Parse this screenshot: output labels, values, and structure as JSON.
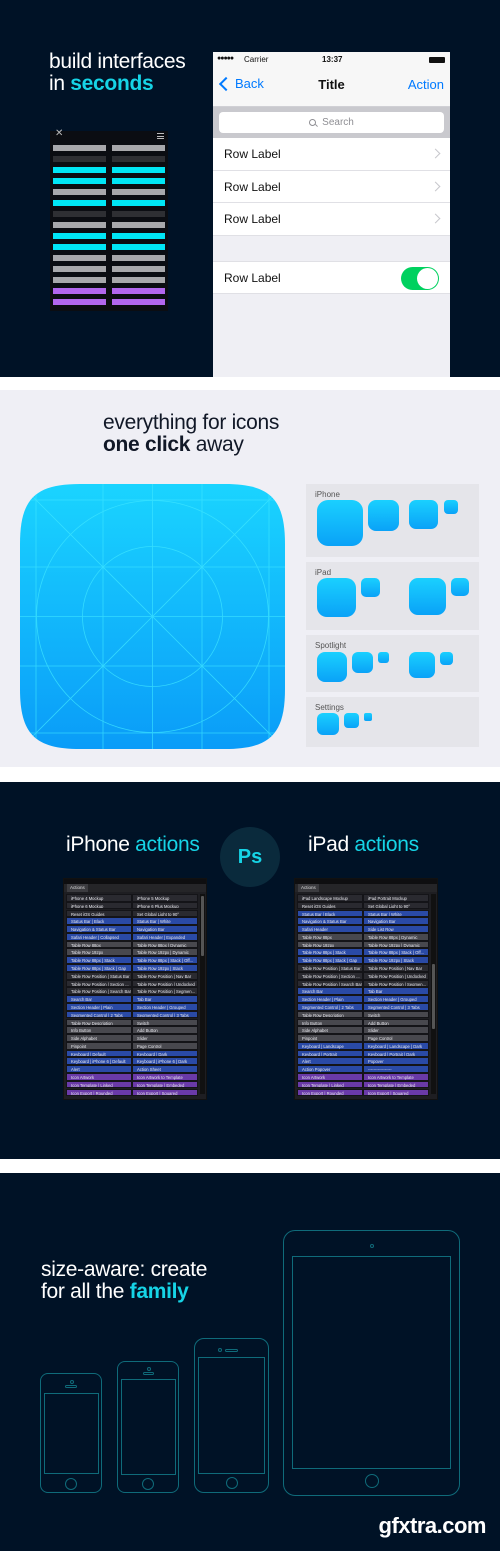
{
  "colors": {
    "dark_bg": "#001226",
    "cyan_accent": "#16d4e6",
    "ios_blue": "#007aff",
    "toggle_green": "#00d15f",
    "light_bg": "#efeff5",
    "device_outline": "#0f6b7a",
    "row_blue": "#2a4aa6",
    "row_gray": "#48484e",
    "row_dark": "#2a2a30",
    "row_purple": "#6a3aa8"
  },
  "section_interfaces": {
    "headline_line1": "build interfaces",
    "headline_line2_plain": "in ",
    "headline_line2_highlight": "seconds",
    "mini_panel": {
      "close_icon": "close-icon",
      "menu_icon": "menu-icon",
      "rows": [
        "gray",
        "dark",
        "cyan",
        "cyan",
        "gray",
        "cyan",
        "dark",
        "gray",
        "cyan",
        "cyan",
        "gray",
        "gray",
        "gray",
        "purple",
        "purple"
      ]
    },
    "phone": {
      "signal": "●●●●●",
      "carrier": "Carrier",
      "time": "13:37",
      "back_label": "Back",
      "title": "Title",
      "action_label": "Action",
      "search_placeholder": "Search",
      "rows": [
        {
          "label": "Row Label",
          "accessory": "disclosure"
        },
        {
          "label": "Row Label",
          "accessory": "disclosure"
        },
        {
          "label": "Row Label",
          "accessory": "disclosure"
        }
      ],
      "toggle_row": {
        "label": "Row Label",
        "on": true
      }
    }
  },
  "section_icons": {
    "headline_line1": "everything for icons",
    "headline_line2_highlight": "one click",
    "headline_line2_plain": " away",
    "cards": [
      {
        "label": "iPhone"
      },
      {
        "label": "iPad"
      },
      {
        "label": "Spotlight"
      },
      {
        "label": "Settings"
      }
    ]
  },
  "section_actions": {
    "left_title_plain": "iPhone ",
    "left_title_highlight": "actions",
    "ps_badge": "Ps",
    "right_title_plain": "iPad ",
    "right_title_highlight": "actions",
    "iphone_panel": {
      "tab": "Actions",
      "rows": [
        {
          "c": "dark",
          "a": "iPhone 4 Mockup",
          "b": "iPhone 5 Mockup"
        },
        {
          "c": "dark",
          "a": "iPhone 6 Mockup",
          "b": "iPhone 6 Plus Mockup"
        },
        {
          "c": "dark",
          "a": "Reset iOS Guides",
          "b": "Set Global Light to 90°"
        },
        {
          "c": "blue",
          "a": "Status Bar | Black",
          "b": "Status Bar | White"
        },
        {
          "c": "blue",
          "a": "Navigation & Status Bar",
          "b": "Navigation Bar"
        },
        {
          "c": "blue",
          "a": "Safari Header | Collapsed",
          "b": "Safari Header | Expanded"
        },
        {
          "c": "gray",
          "a": "Table Row 88px",
          "b": "Table Row 88px | Dynamic"
        },
        {
          "c": "gray",
          "a": "Table Row 192px",
          "b": "Table Row 192px | Dynamic"
        },
        {
          "c": "blue",
          "a": "Table Row 88px | Stack",
          "b": "Table Row 88px | Stack | Off..."
        },
        {
          "c": "blue",
          "a": "Table Row 88px | Stack | Gap",
          "b": "Table Row 192px | Stack"
        },
        {
          "c": "dark",
          "a": "Table Row Position | Status Bar",
          "b": "Table Row Position | Nav Bar"
        },
        {
          "c": "dark",
          "a": "Table Row Position | Section ...",
          "b": "Table Row Position | Undocked"
        },
        {
          "c": "dark",
          "a": "Table Row Position | Search Bar",
          "b": "Table Row Position | Segmen..."
        },
        {
          "c": "blue",
          "a": "Search Bar",
          "b": "Tab Bar"
        },
        {
          "c": "blue",
          "a": "Section Header | Plain",
          "b": "Section Header | Grouped"
        },
        {
          "c": "blue",
          "a": "Segmented Control | 2 Tabs",
          "b": "Segmented Control | 3 Tabs"
        },
        {
          "c": "gray",
          "a": "Table Row Description",
          "b": "Switch"
        },
        {
          "c": "gray",
          "a": "Info Button",
          "b": "Add Button"
        },
        {
          "c": "gray",
          "a": "Side Alphabet",
          "b": "Slider"
        },
        {
          "c": "gray",
          "a": "Pinpoint",
          "b": "Page Control"
        },
        {
          "c": "blue",
          "a": "Keyboard | Default",
          "b": "Keyboard | Dark"
        },
        {
          "c": "blue",
          "a": "Keyboard | iPhone 6 | Default",
          "b": "Keyboard | iPhone 6 | Dark"
        },
        {
          "c": "blue",
          "a": "Alert",
          "b": "Action Sheet"
        },
        {
          "c": "purple",
          "a": "Icon Artwork",
          "b": "Icon Artwork to Template"
        },
        {
          "c": "purple",
          "a": "Icon Template | Linked",
          "b": "Icon Template | Embeded"
        },
        {
          "c": "purple",
          "a": "Icon Export | Rounded",
          "b": "Icon Export | Squared"
        }
      ]
    },
    "ipad_panel": {
      "tab": "Actions",
      "rows": [
        {
          "c": "dark",
          "a": "iPad Landscape Mockup",
          "b": "iPad Portrait Mockup"
        },
        {
          "c": "dark",
          "a": "Reset iOS Guides",
          "b": "Set Global Light to 90°"
        },
        {
          "c": "blue",
          "a": "Status Bar | Black",
          "b": "Status Bar | White"
        },
        {
          "c": "blue",
          "a": "Navigation & Status Bar",
          "b": "Navigation Bar"
        },
        {
          "c": "blue",
          "a": "Safari Header",
          "b": "Side List Row"
        },
        {
          "c": "gray",
          "a": "Table Row 88px",
          "b": "Table Row 88px | Dynamic"
        },
        {
          "c": "gray",
          "a": "Table Row 192px",
          "b": "Table Row 192px | Dynamic"
        },
        {
          "c": "blue",
          "a": "Table Row 88px | Stack",
          "b": "Table Row 88px | Stack | Off..."
        },
        {
          "c": "blue",
          "a": "Table Row 88px | Stack | Gap",
          "b": "Table Row 192px | Stack"
        },
        {
          "c": "dark",
          "a": "Table Row Position | Status Bar",
          "b": "Table Row Position | Nav Bar"
        },
        {
          "c": "dark",
          "a": "Table Row Position | Section ...",
          "b": "Table Row Position | Undocked"
        },
        {
          "c": "dark",
          "a": "Table Row Position | Search Bar",
          "b": "Table Row Position | Segmen..."
        },
        {
          "c": "blue",
          "a": "Search Bar",
          "b": "Tab Bar"
        },
        {
          "c": "blue",
          "a": "Section Header | Plain",
          "b": "Section Header | Grouped"
        },
        {
          "c": "blue",
          "a": "Segmented Control | 2 Tabs",
          "b": "Segmented Control | 3 Tabs"
        },
        {
          "c": "gray",
          "a": "Table Row Description",
          "b": "Switch"
        },
        {
          "c": "gray",
          "a": "Info Button",
          "b": "Add Button"
        },
        {
          "c": "gray",
          "a": "Side Alphabet",
          "b": "Slider"
        },
        {
          "c": "gray",
          "a": "Pinpoint",
          "b": "Page Control"
        },
        {
          "c": "blue",
          "a": "Keyboard | Landscape",
          "b": "Keyboard | Landscape | Dark"
        },
        {
          "c": "blue",
          "a": "Keyboard | Portrait",
          "b": "Keyboard | Portrait | Dark"
        },
        {
          "c": "blue",
          "a": "Alert",
          "b": "Popover"
        },
        {
          "c": "blue",
          "a": "Action Popover",
          "b": "-----------------"
        },
        {
          "c": "purple",
          "a": "Icon Artwork",
          "b": "Icon Artwork to Template"
        },
        {
          "c": "purple",
          "a": "Icon Template | Linked",
          "b": "Icon Template | Embeded"
        },
        {
          "c": "purple",
          "a": "Icon Export | Rounded",
          "b": "Icon Export | Squared"
        }
      ]
    }
  },
  "section_family": {
    "headline_line1": "size-aware: create",
    "headline_line2_plain": "for all the ",
    "headline_line2_highlight": "family",
    "devices": [
      "iPhone 4",
      "iPhone 5",
      "iPhone 6",
      "iPad"
    ],
    "watermark": "gfxtra.com"
  }
}
